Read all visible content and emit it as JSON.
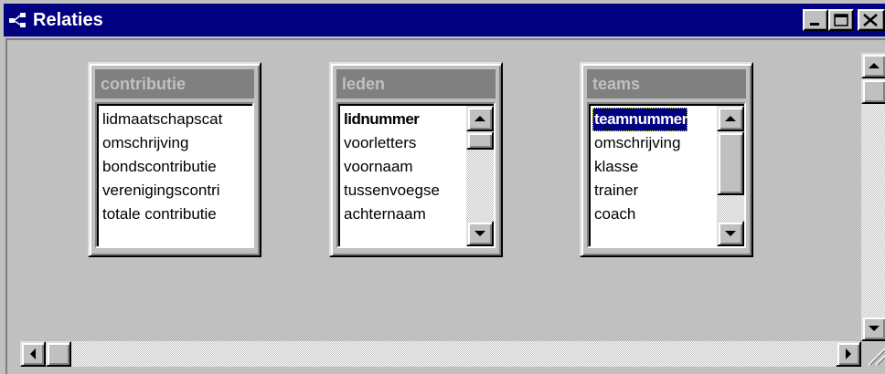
{
  "window": {
    "title": "Relaties",
    "controls": {
      "minimize": "minimize",
      "maximize": "maximize",
      "close": "close"
    }
  },
  "tables": [
    {
      "name": "contributie",
      "fields": [
        "lidmaatschapscat",
        "omschrijving",
        "bondscontributie",
        "verenigingscontri",
        "totale contributie"
      ],
      "key_field_index": null,
      "selected_field_index": null,
      "has_scrollbar": false
    },
    {
      "name": "leden",
      "fields": [
        "lidnummer",
        "voorletters",
        "voornaam",
        "tussenvoegse",
        "achternaam"
      ],
      "key_field_index": 0,
      "selected_field_index": null,
      "has_scrollbar": true,
      "scroll_position": 0
    },
    {
      "name": "teams",
      "fields": [
        "teamnummer",
        "omschrijving",
        "klasse",
        "trainer",
        "coach"
      ],
      "key_field_index": 0,
      "selected_field_index": 0,
      "has_scrollbar": true,
      "scroll_position": 0
    }
  ],
  "colors": {
    "titlebar": "#000080",
    "face": "#c0c0c0",
    "table_header": "#808080",
    "selection": "#000080"
  }
}
